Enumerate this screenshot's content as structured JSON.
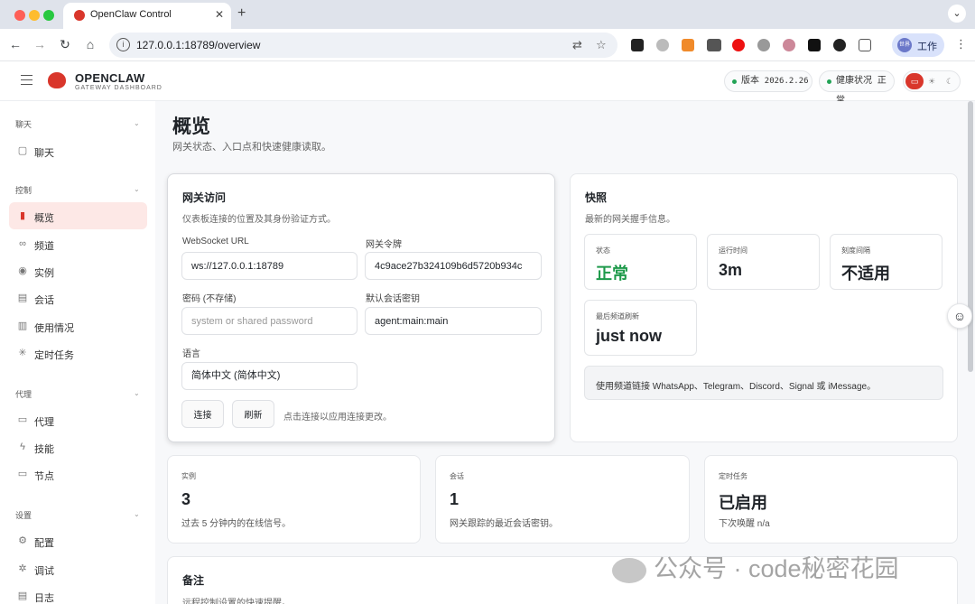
{
  "browser": {
    "tab_title": "OpenClaw Control",
    "tab_close": "✕",
    "new_tab": "+",
    "tab_menu": "⌄",
    "url": "127.0.0.1:18789/overview",
    "profile_label": "工作",
    "profile_avatar": "世界"
  },
  "header": {
    "brand": "OPENCLAW",
    "brand_sub": "GATEWAY DASHBOARD",
    "version_label": "版本",
    "version": "2026.2.26",
    "health_label": "健康状况",
    "health": "正常"
  },
  "sidebar": {
    "groups": [
      {
        "label": "聊天",
        "items": [
          {
            "label": "聊天",
            "icon": "chat-icon"
          }
        ]
      },
      {
        "label": "控制",
        "items": [
          {
            "label": "概览",
            "icon": "bar-chart-icon",
            "active": true
          },
          {
            "label": "频道",
            "icon": "link-icon"
          },
          {
            "label": "实例",
            "icon": "broadcast-icon"
          },
          {
            "label": "会话",
            "icon": "document-icon"
          },
          {
            "label": "使用情况",
            "icon": "usage-icon"
          },
          {
            "label": "定时任务",
            "icon": "loader-icon"
          }
        ]
      },
      {
        "label": "代理",
        "items": [
          {
            "label": "代理",
            "icon": "folder-icon"
          },
          {
            "label": "技能",
            "icon": "bolt-icon"
          },
          {
            "label": "节点",
            "icon": "monitor-icon"
          }
        ]
      },
      {
        "label": "设置",
        "items": [
          {
            "label": "配置",
            "icon": "gear-icon"
          },
          {
            "label": "调试",
            "icon": "bug-icon"
          },
          {
            "label": "日志",
            "icon": "log-icon"
          }
        ]
      }
    ]
  },
  "page": {
    "title": "概览",
    "subtitle": "网关状态、入口点和快速健康读取。"
  },
  "access": {
    "title": "网关访问",
    "subtitle": "仪表板连接的位置及其身份验证方式。",
    "ws_label": "WebSocket URL",
    "ws_value": "ws://127.0.0.1:18789",
    "token_label": "网关令牌",
    "token_value": "4c9ace27b324109b6d5720b934c",
    "password_label": "密码 (不存储)",
    "password_placeholder": "system or shared password",
    "session_label": "默认会话密钥",
    "session_value": "agent:main:main",
    "language_label": "语言",
    "language_value": "简体中文 (简体中文)",
    "connect_label": "连接",
    "refresh_label": "刷新",
    "hint": "点击连接以应用连接更改。"
  },
  "snapshot": {
    "title": "快照",
    "subtitle": "最新的网关握手信息。",
    "stats": [
      {
        "label": "状态",
        "value": "正常"
      },
      {
        "label": "运行时间",
        "value": "3m"
      },
      {
        "label": "刻度间隔",
        "value": "不适用"
      },
      {
        "label": "最后频道刷新",
        "value": "just now"
      }
    ],
    "info": "使用频道链接 WhatsApp、Telegram、Discord、Signal 或 iMessage。"
  },
  "metrics": [
    {
      "label": "实例",
      "value": "3",
      "desc": "过去 5 分钟内的在线信号。"
    },
    {
      "label": "会话",
      "value": "1",
      "desc": "网关跟踪的最近会话密钥。"
    },
    {
      "label": "定时任务",
      "value": "已启用",
      "desc": "下次唤醒 n/a"
    }
  ],
  "notes": {
    "title": "备注",
    "subtitle": "远程控制设置的快速提醒。"
  },
  "watermark": "公众号 · code秘密花园",
  "colors": {
    "accent": "#d9362b",
    "ok": "#1f9a4b",
    "active_bg": "#fde8e6"
  }
}
